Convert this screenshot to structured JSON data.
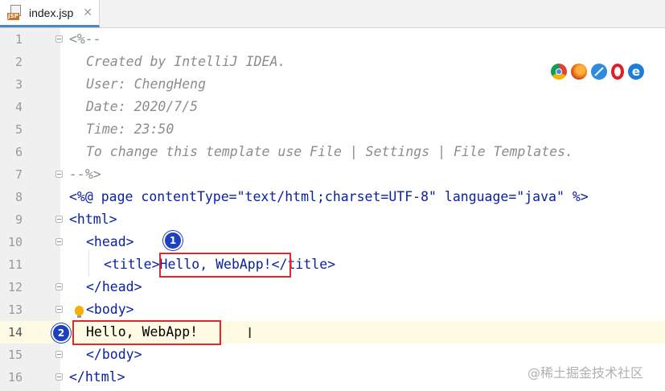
{
  "tab": {
    "file_type": "JSP",
    "name": "index.jsp",
    "close_glyph": "✕"
  },
  "lines": [
    {
      "num": "1",
      "text": "<%--"
    },
    {
      "num": "2",
      "text": "Created by IntelliJ IDEA."
    },
    {
      "num": "3",
      "text": "User: ChengHeng"
    },
    {
      "num": "4",
      "text": "Date: 2020/7/5"
    },
    {
      "num": "5",
      "text": "Time: 23:50"
    },
    {
      "num": "6",
      "text": "To change this template use File | Settings | File Templates."
    },
    {
      "num": "7",
      "text": "--%>"
    },
    {
      "num": "8",
      "text": "<%@ page contentType=\"text/html;charset=UTF-8\" language=\"java\" %>"
    },
    {
      "num": "9",
      "text": "<html>"
    },
    {
      "num": "10",
      "text": "<head>"
    },
    {
      "num": "11",
      "text": "<title>Hello, WebApp!</title>"
    },
    {
      "num": "12",
      "text": "</head>"
    },
    {
      "num": "13",
      "text": "<body>"
    },
    {
      "num": "14",
      "text": "Hello, WebApp!"
    },
    {
      "num": "15",
      "text": "</body>"
    },
    {
      "num": "16",
      "text": "</html>"
    }
  ],
  "browsers": [
    "chrome-icon",
    "firefox-icon",
    "safari-icon",
    "opera-icon",
    "ie-icon"
  ],
  "callouts": {
    "one": "1",
    "two": "2"
  },
  "watermark": "@稀土掘金技术社区",
  "colors": {
    "highlight_border": "#e5262a",
    "badge": "#1e3fbf",
    "current_line": "#fffae3",
    "tag": "#0a21a0",
    "string": "#0b7a23",
    "comment": "#8c8c8c"
  }
}
